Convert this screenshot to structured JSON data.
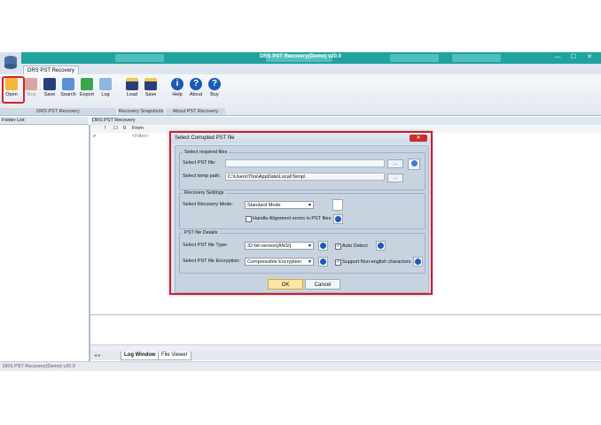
{
  "window": {
    "title": "DRS PST Recovery(Demo) v20.0",
    "min": "—",
    "max": "☐",
    "close": "✕"
  },
  "ribbon": {
    "tab": "DRS PST Recovery",
    "groups": [
      {
        "label": "DRS PST Recovery"
      },
      {
        "label": "Recovery Snapshots"
      },
      {
        "label": "About PST Recovery"
      }
    ],
    "buttons": {
      "open": "Open",
      "stop": "Stop",
      "save": "Save",
      "search": "Search",
      "export": "Export",
      "log": "Log",
      "load": "Load",
      "save2": "Save",
      "help": "Help",
      "about": "About",
      "buy": "Buy"
    }
  },
  "left_panel": {
    "header": "Folder List"
  },
  "right_panel": {
    "header": "DRS PST Recovery",
    "columns": [
      "!",
      "☐",
      "0",
      "From"
    ],
    "filter": "<Filter>"
  },
  "bottom_tabs": [
    "Log Window",
    "File Viewer"
  ],
  "status": "DRS PST Recovery(Demo) v20.0",
  "dialog": {
    "title": "Select Corrupted PST file",
    "required": {
      "legend": "Select required files",
      "pst_label": "Select PST file:",
      "pst_value": "",
      "temp_label": "Select temp path:",
      "temp_value": "C:\\Users\\This\\AppData\\Local\\Temp\\",
      "browse": "..."
    },
    "settings": {
      "legend": "Recovery Settings",
      "mode_label": "Select Recovery Mode:",
      "mode_value": "Standard Mode",
      "align_label": "Handle Alignment errors in PST files"
    },
    "details": {
      "legend": "PST file Details",
      "type_label": "Select PST file Type:",
      "type_value": "32-bit-version[ANSI]",
      "autodetect_label": "Auto Detect",
      "enc_label": "Select PST file Encryption:",
      "enc_value": "Compressible Encryption",
      "nonenglish_label": "Support Non-english characters"
    },
    "ok": "OK",
    "cancel": "Cancel"
  }
}
